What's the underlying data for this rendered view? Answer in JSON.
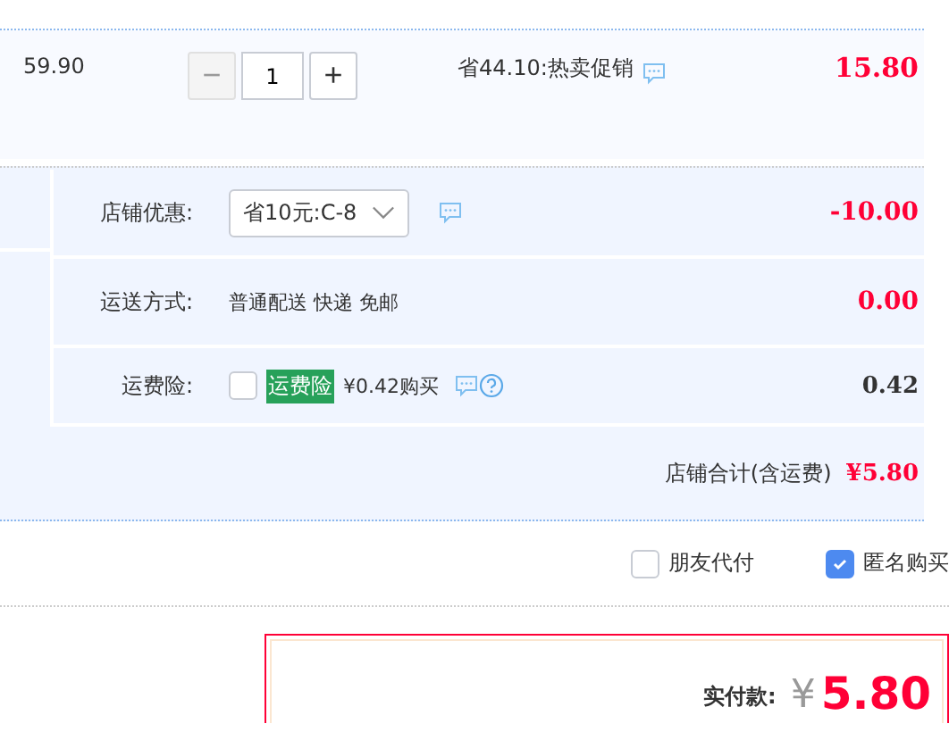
{
  "item": {
    "unit_price": "59.90",
    "quantity": {
      "minus": "−",
      "value": "1",
      "plus": "+",
      "minus_disabled": true
    },
    "promotion": "省44.10:热卖促销",
    "subtotal": "15.80"
  },
  "store_rows": [
    {
      "kind": "select",
      "label": "店铺优惠:",
      "value": "省10元:C-8",
      "amount": "-10.00",
      "amount_red": true
    },
    {
      "kind": "text",
      "label": "运送方式:",
      "value": "普通配送 快递 免邮",
      "amount": "0.00",
      "amount_red": true
    },
    {
      "kind": "insurance",
      "label": "运费险:",
      "checked": false,
      "badge": "运费险",
      "value": "¥0.42购买",
      "amount": "0.42",
      "amount_red": false
    }
  ],
  "store_total": {
    "label": "店铺合计(含运费)",
    "value": "¥5.80"
  },
  "options": [
    {
      "label": "朋友代付",
      "checked": false
    },
    {
      "label": "匿名购买",
      "checked": true
    }
  ],
  "payment": {
    "label": "实付款:",
    "currency": "¥",
    "value": "5.80"
  }
}
